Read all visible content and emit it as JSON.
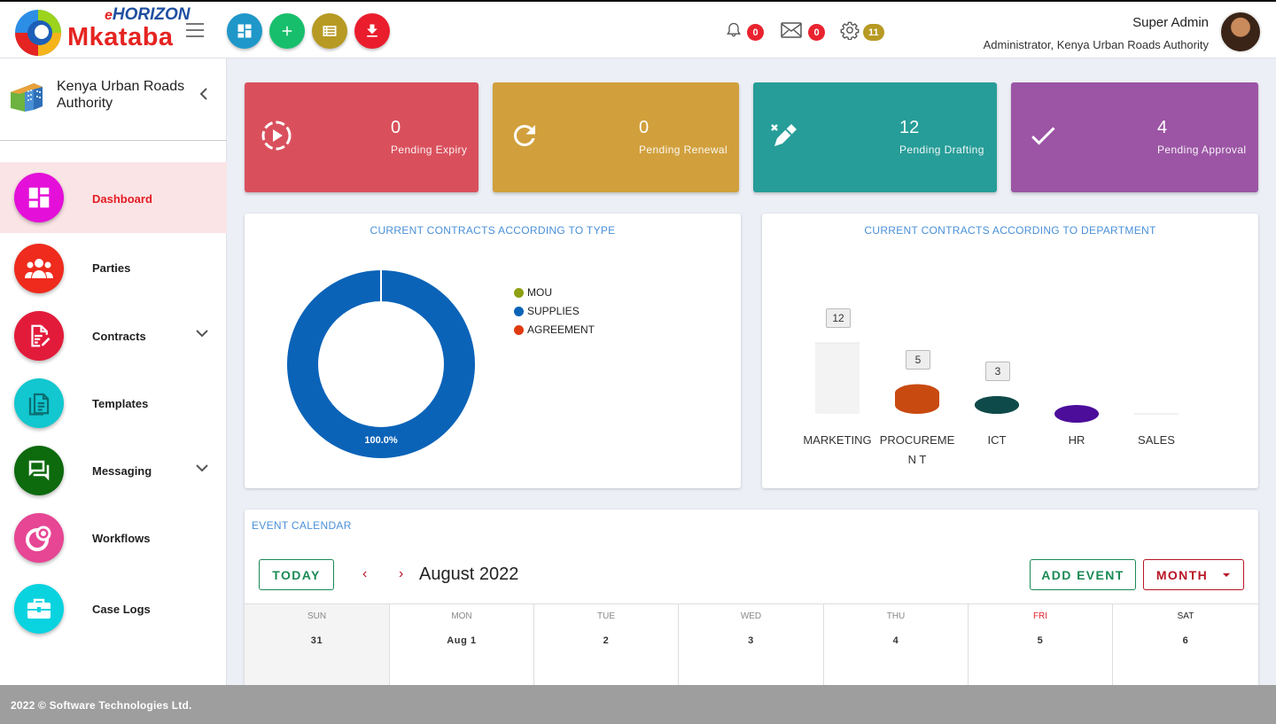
{
  "brand": {
    "e": "e",
    "horizon": "HORIZON",
    "name": "Mkataba"
  },
  "header": {
    "notifications": {
      "bell": "0",
      "mail": "0",
      "settings": "11"
    },
    "user": {
      "name": "Super Admin",
      "role": "Administrator, Kenya Urban Roads Authority"
    }
  },
  "sidebar": {
    "org": "Kenya Urban Roads Authority",
    "items": [
      {
        "label": "Dashboard",
        "icon": "dashboard-icon",
        "color": "#e40fd9"
      },
      {
        "label": "Parties",
        "icon": "people-icon",
        "color": "#ee2b1d"
      },
      {
        "label": "Contracts",
        "icon": "contract-edit-icon",
        "color": "#e31b3a"
      },
      {
        "label": "Templates",
        "icon": "document-icon",
        "color": "#12c7cf"
      },
      {
        "label": "Messaging",
        "icon": "chat-icon",
        "color": "#0d6a0d"
      },
      {
        "label": "Workflows",
        "icon": "workflow-icon",
        "color": "#e64694"
      },
      {
        "label": "Case Logs",
        "icon": "briefcase-icon",
        "color": "#0ad3e0"
      }
    ]
  },
  "stats": [
    {
      "value": "0",
      "label": "Pending Expiry",
      "color": "#d9505c"
    },
    {
      "value": "0",
      "label": "Pending Renewal",
      "color": "#d1a03c"
    },
    {
      "value": "12",
      "label": "Pending Drafting",
      "color": "#269d98"
    },
    {
      "value": "4",
      "label": "Pending Approval",
      "color": "#9b55a4"
    }
  ],
  "type_chart": {
    "title": "CURRENT CONTRACTS ACCORDING TO TYPE",
    "center_label": "100.0%"
  },
  "dept_chart": {
    "title": "CURRENT CONTRACTS ACCORDING TO DEPARTMENT"
  },
  "chart_data": [
    {
      "type": "pie",
      "title": "CURRENT CONTRACTS ACCORDING TO TYPE",
      "categories": [
        "MOU",
        "SUPPLIES",
        "AGREEMENT"
      ],
      "values": [
        0,
        100,
        0
      ],
      "colors": [
        "#8ea013",
        "#0b63b8",
        "#e03b10"
      ],
      "legend": "right"
    },
    {
      "type": "bar",
      "title": "CURRENT CONTRACTS ACCORDING TO DEPARTMENT",
      "categories": [
        "MARKETING",
        "PROCUREMEN T",
        "ICT",
        "HR",
        "SALES"
      ],
      "values": [
        12,
        5,
        3,
        0,
        0
      ],
      "data_labels": [
        "12",
        "5",
        "3"
      ],
      "colors": [
        "#f3f3f3",
        "#c84a10",
        "#0f4a4a",
        "#4b0d9a",
        "#f5f5f5"
      ]
    }
  ],
  "calendar": {
    "title": "EVENT CALENDAR",
    "today": "TODAY",
    "prev": "‹",
    "next": "›",
    "month": "August 2022",
    "add_event": "ADD EVENT",
    "view": "MONTH",
    "days": [
      {
        "name": "SUN",
        "num": "31"
      },
      {
        "name": "MON",
        "num": "Aug 1"
      },
      {
        "name": "TUE",
        "num": "2"
      },
      {
        "name": "WED",
        "num": "3"
      },
      {
        "name": "THU",
        "num": "4"
      },
      {
        "name": "FRI",
        "num": "5"
      },
      {
        "name": "SAT",
        "num": "6"
      }
    ]
  },
  "footer": {
    "text": "2022 © Software Technologies Ltd."
  }
}
